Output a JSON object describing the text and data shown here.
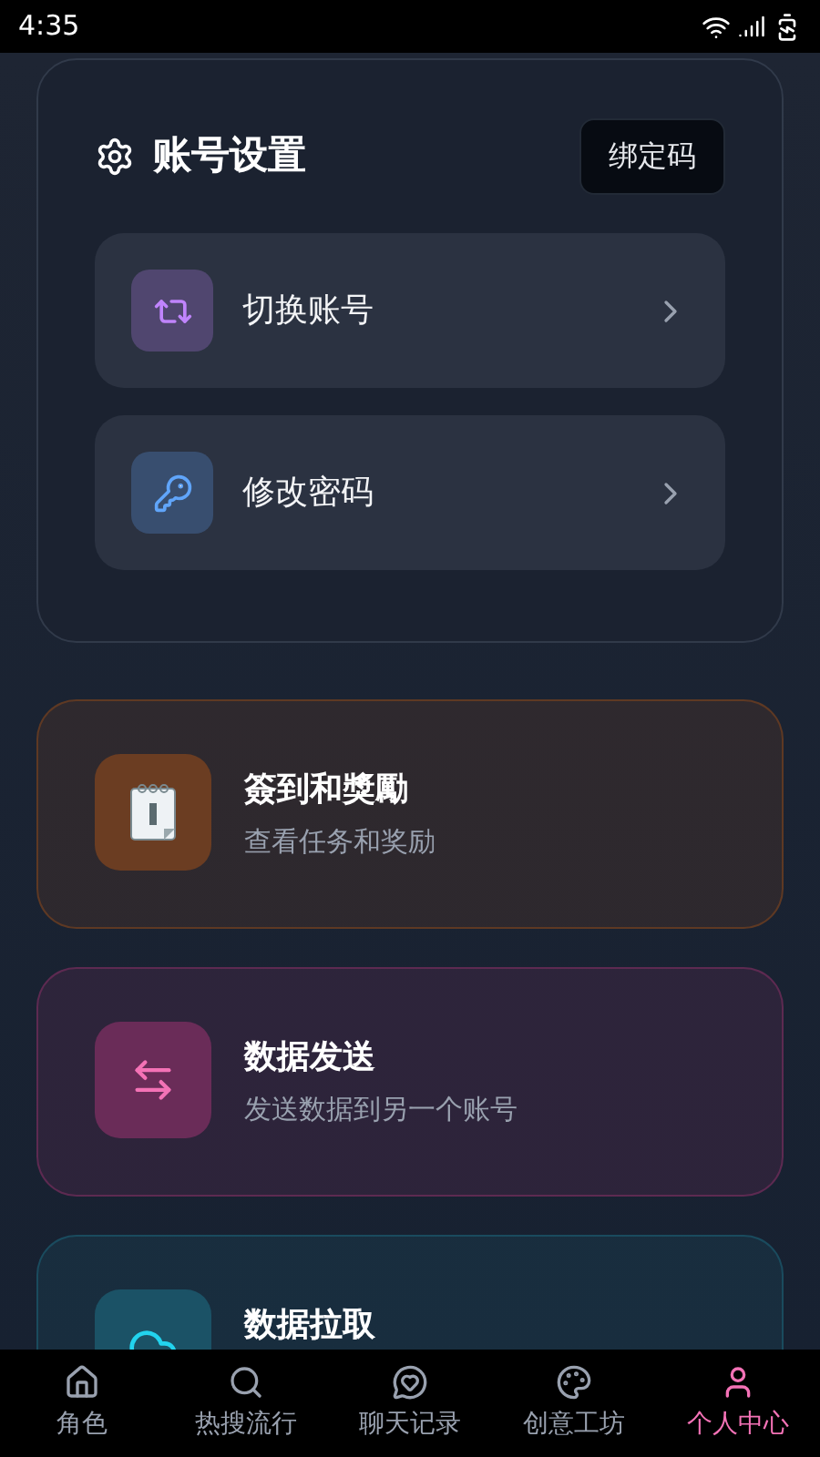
{
  "status_bar": {
    "time": "4:35"
  },
  "account_settings": {
    "title": "账号设置",
    "bind_button": "绑定码",
    "items": [
      {
        "label": "切换账号",
        "color": "#c084fc"
      },
      {
        "label": "修改密码",
        "color": "#60a5fa"
      }
    ]
  },
  "features": [
    {
      "title": "簽到和獎勵",
      "subtitle": "查看任务和奖励",
      "color": "#6b3d22"
    },
    {
      "title": "数据发送",
      "subtitle": "发送数据到另一个账号",
      "color": "#6a2c58"
    },
    {
      "title": "数据拉取",
      "color": "#1b5266"
    }
  ],
  "bottom_nav": [
    {
      "label": "角色",
      "selected": false
    },
    {
      "label": "热搜流行",
      "selected": false
    },
    {
      "label": "聊天记录",
      "selected": false
    },
    {
      "label": "创意工坊",
      "selected": false
    },
    {
      "label": "个人中心",
      "selected": true
    }
  ]
}
